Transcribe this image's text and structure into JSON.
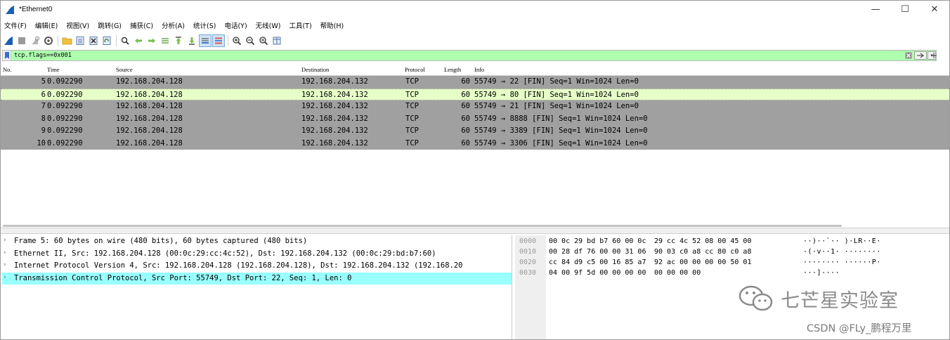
{
  "window": {
    "title": "*Ethernet0",
    "minimize": "—",
    "maximize": "☐",
    "close": "✕"
  },
  "menu": {
    "items": [
      "文件(F)",
      "编辑(E)",
      "视图(V)",
      "跳转(G)",
      "捕获(C)",
      "分析(A)",
      "统计(S)",
      "电话(Y)",
      "无线(W)",
      "工具(T)",
      "帮助(H)"
    ]
  },
  "filter": {
    "value": "tcp.flags==0x001",
    "add_label": "+",
    "background_color": "#afffaf"
  },
  "packet_list": {
    "columns": {
      "no": "No.",
      "time": "Time",
      "source": "Source",
      "destination": "Destination",
      "protocol": "Protocol",
      "length": "Length",
      "info": "Info"
    },
    "rows": [
      {
        "no": "5",
        "time": "0.092290",
        "source": "192.168.204.128",
        "destination": "192.168.204.132",
        "protocol": "TCP",
        "length": "60",
        "info": "55749 → 22 [FIN] Seq=1 Win=1024 Len=0"
      },
      {
        "no": "6",
        "time": "0.092290",
        "source": "192.168.204.128",
        "destination": "192.168.204.132",
        "protocol": "TCP",
        "length": "60",
        "info": "55749 → 80 [FIN] Seq=1 Win=1024 Len=0"
      },
      {
        "no": "7",
        "time": "0.092290",
        "source": "192.168.204.128",
        "destination": "192.168.204.132",
        "protocol": "TCP",
        "length": "60",
        "info": "55749 → 21 [FIN] Seq=1 Win=1024 Len=0"
      },
      {
        "no": "8",
        "time": "0.092290",
        "source": "192.168.204.128",
        "destination": "192.168.204.132",
        "protocol": "TCP",
        "length": "60",
        "info": "55749 → 8888 [FIN] Seq=1 Win=1024 Len=0"
      },
      {
        "no": "9",
        "time": "0.092290",
        "source": "192.168.204.128",
        "destination": "192.168.204.132",
        "protocol": "TCP",
        "length": "60",
        "info": "55749 → 3389 [FIN] Seq=1 Win=1024 Len=0"
      },
      {
        "no": "10",
        "time": "0.092290",
        "source": "192.168.204.128",
        "destination": "192.168.204.132",
        "protocol": "TCP",
        "length": "60",
        "info": "55749 → 3306 [FIN] Seq=1 Win=1024 Len=0"
      }
    ],
    "row_color": "#a0a0a0",
    "selected_row_color": "#e6ffc8"
  },
  "details": {
    "items": [
      "Frame 5: 60 bytes on wire (480 bits), 60 bytes captured (480 bits)",
      "Ethernet II, Src: 192.168.204.128 (00:0c:29:cc:4c:52), Dst: 192.168.204.132 (00:0c:29:bd:b7:60)",
      "Internet Protocol Version 4, Src: 192.168.204.128 (192.168.204.128), Dst: 192.168.204.132 (192.168.20",
      "Transmission Control Protocol, Src Port: 55749, Dst Port: 22, Seq: 1, Len: 0"
    ],
    "arrow": "›",
    "selected_color": "#99ffff"
  },
  "bytes": {
    "rows": [
      {
        "offset": "0000",
        "hex1": "00 0c 29 bd b7 60 00 0c",
        "hex2": "29 cc 4c 52 08 00 45 00",
        "ascii": "··)··`·· )·LR··E·"
      },
      {
        "offset": "0010",
        "hex1": "00 28 df 76 00 00 31 06",
        "hex2": "90 03 c0 a8 cc 80 c0 a8",
        "ascii": "·(·v··1· ········"
      },
      {
        "offset": "0020",
        "hex1": "cc 84 d9 c5 00 16 85 a7",
        "hex2": "92 ac 00 00 00 00 50 01",
        "ascii": "········ ······P·"
      },
      {
        "offset": "0030",
        "hex1": "04 00 9f 5d 00 00 00 00",
        "hex2": "00 00 00 00",
        "ascii": "···]····"
      }
    ]
  },
  "watermark": {
    "lab": "七芒星实验室",
    "csdn": "CSDN @FLy_鹏程万里"
  }
}
